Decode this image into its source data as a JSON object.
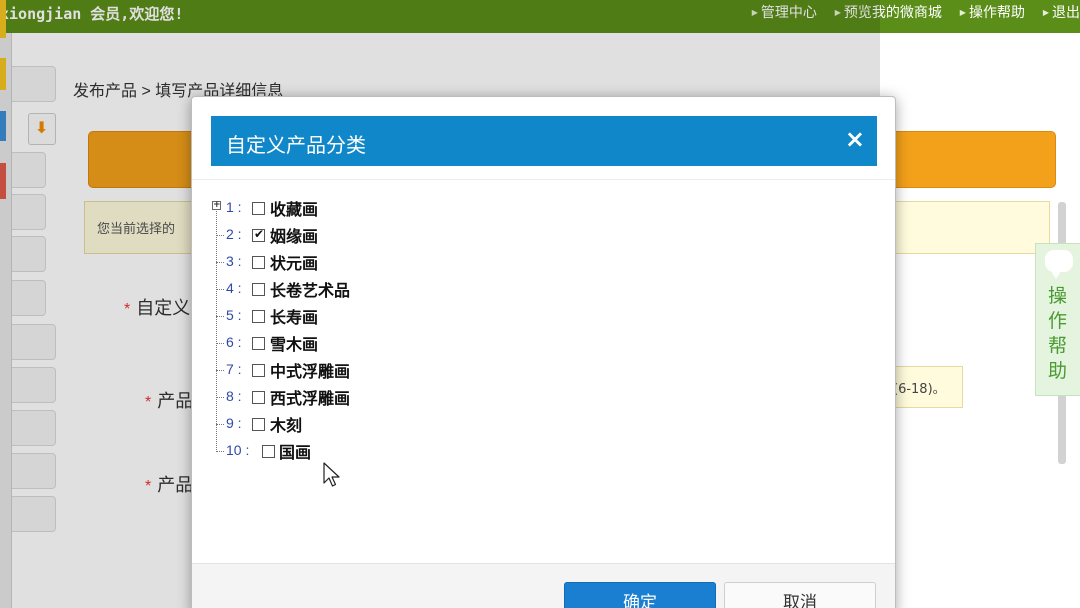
{
  "topbar": {
    "welcome": "xiongjian 会员,欢迎您!",
    "nav": [
      "管理中心",
      "预览我的微商城",
      "操作帮助",
      "退出"
    ]
  },
  "page": {
    "breadcrumb": "发布产品 > 填写产品详细信息",
    "info_text": "您当前选择的",
    "field_labels": [
      "自定义",
      "产品",
      "产品"
    ],
    "hint_text": "(6-18)。",
    "help_tab": "操作帮助"
  },
  "dialog": {
    "title": "自定义产品分类",
    "close_symbol": "×",
    "items": [
      {
        "num": "1",
        "label": "收藏画",
        "checked": false,
        "expandable": true
      },
      {
        "num": "2",
        "label": "姻缘画",
        "checked": true,
        "expandable": false
      },
      {
        "num": "3",
        "label": "状元画",
        "checked": false,
        "expandable": false
      },
      {
        "num": "4",
        "label": "长卷艺术品",
        "checked": false,
        "expandable": false
      },
      {
        "num": "5",
        "label": "长寿画",
        "checked": false,
        "expandable": false
      },
      {
        "num": "6",
        "label": "雪木画",
        "checked": false,
        "expandable": false
      },
      {
        "num": "7",
        "label": "中式浮雕画",
        "checked": false,
        "expandable": false
      },
      {
        "num": "8",
        "label": "西式浮雕画",
        "checked": false,
        "expandable": false
      },
      {
        "num": "9",
        "label": "木刻",
        "checked": false,
        "expandable": false
      },
      {
        "num": "10",
        "label": "国画",
        "checked": false,
        "expandable": false
      }
    ],
    "ok_label": "确定",
    "cancel_label": "取消"
  },
  "colors": {
    "topbar": "#5a8e19",
    "dialog_header": "#0f87c9",
    "orange_bar": "#f3a11b",
    "ok_button": "#1b7fd1"
  },
  "icons": [
    "arrow-down-icon",
    "close-icon",
    "expand-plus-icon",
    "chat-bubble-icon",
    "mouse-cursor-icon"
  ]
}
